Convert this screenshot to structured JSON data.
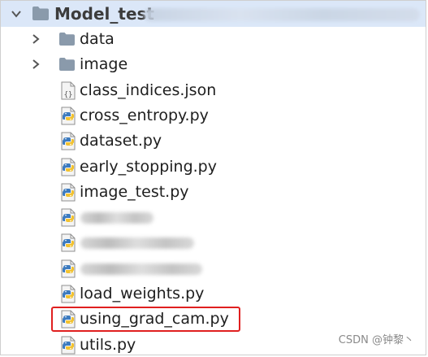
{
  "root": {
    "label": "Model_test",
    "expanded": true,
    "icon": "folder-icon"
  },
  "items": [
    {
      "id": "data",
      "kind": "folder",
      "label": "data",
      "icon": "folder-icon"
    },
    {
      "id": "image",
      "kind": "folder",
      "label": "image",
      "icon": "folder-icon"
    },
    {
      "id": "class-indices-json",
      "kind": "json",
      "label": "class_indices.json",
      "icon": "json-file-icon"
    },
    {
      "id": "cross-entropy-py",
      "kind": "python",
      "label": "cross_entropy.py",
      "icon": "python-file-icon"
    },
    {
      "id": "dataset-py",
      "kind": "python",
      "label": "dataset.py",
      "icon": "python-file-icon"
    },
    {
      "id": "early-stopping-py",
      "kind": "python",
      "label": "early_stopping.py",
      "icon": "python-file-icon"
    },
    {
      "id": "image-test-py",
      "kind": "python",
      "label": "image_test.py",
      "icon": "python-file-icon"
    },
    {
      "id": "redacted-1",
      "kind": "python-redacted",
      "label": "",
      "icon": "python-file-icon"
    },
    {
      "id": "redacted-2",
      "kind": "python-redacted",
      "label": "",
      "icon": "python-file-icon"
    },
    {
      "id": "redacted-3",
      "kind": "python-redacted",
      "label": "",
      "icon": "python-file-icon"
    },
    {
      "id": "load-weights-py",
      "kind": "python",
      "label": "load_weights.py",
      "icon": "python-file-icon"
    },
    {
      "id": "using-grad-cam-py",
      "kind": "python",
      "label": "using_grad_cam.py",
      "icon": "python-file-icon",
      "highlighted": true
    },
    {
      "id": "utils-py",
      "kind": "python",
      "label": "utils.py",
      "icon": "python-file-icon"
    }
  ],
  "watermark": "CSDN @钟黎丶",
  "colors": {
    "header_bg": "#dbe7f8",
    "folder": "#8a9aab",
    "highlight_border": "#e02020",
    "python_blue": "#3d7bbf",
    "python_yellow": "#f2c230"
  }
}
